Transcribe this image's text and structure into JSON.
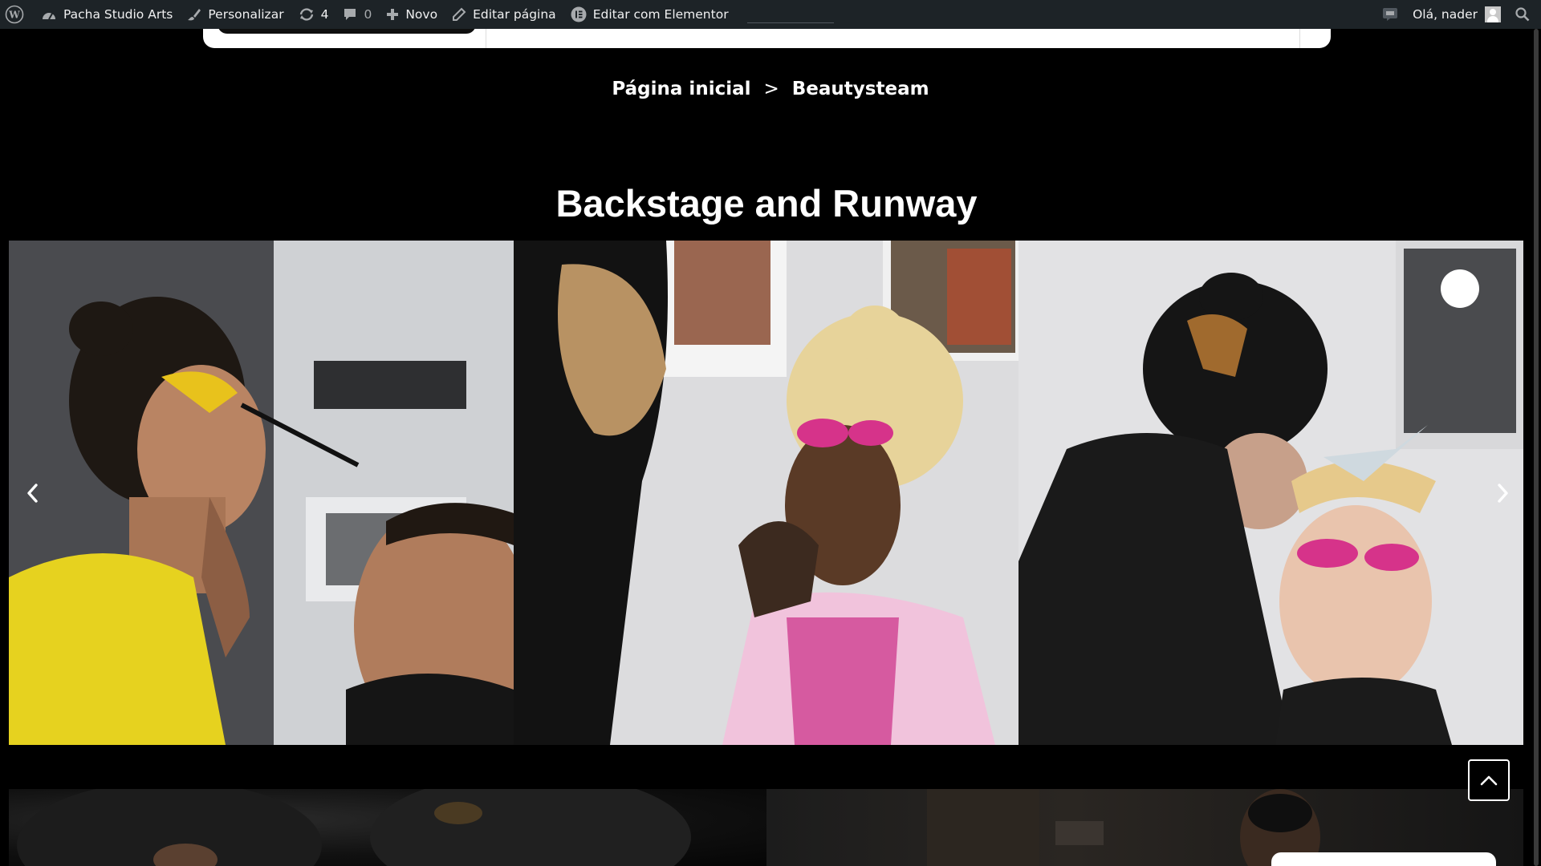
{
  "admin_bar": {
    "site_name": "Pacha Studio Arts",
    "customize_label": "Personalizar",
    "updates_count": "4",
    "comments_count": "0",
    "new_label": "Novo",
    "edit_page_label": "Editar página",
    "elementor_label": "Editar com Elementor",
    "greeting": "Olá, nader"
  },
  "breadcrumb": {
    "home": "Página inicial",
    "separator": ">",
    "current": "Beautysteam"
  },
  "section": {
    "title": "Backstage and Runway"
  },
  "carousel": {
    "prev_icon": "chevron-left-icon",
    "next_icon": "chevron-right-icon"
  },
  "colors": {
    "admin_bar_bg": "#1d2327",
    "page_bg": "#000000",
    "text": "#ffffff",
    "accent_magenta": "#d6338a",
    "accent_yellow": "#e8c21c"
  }
}
